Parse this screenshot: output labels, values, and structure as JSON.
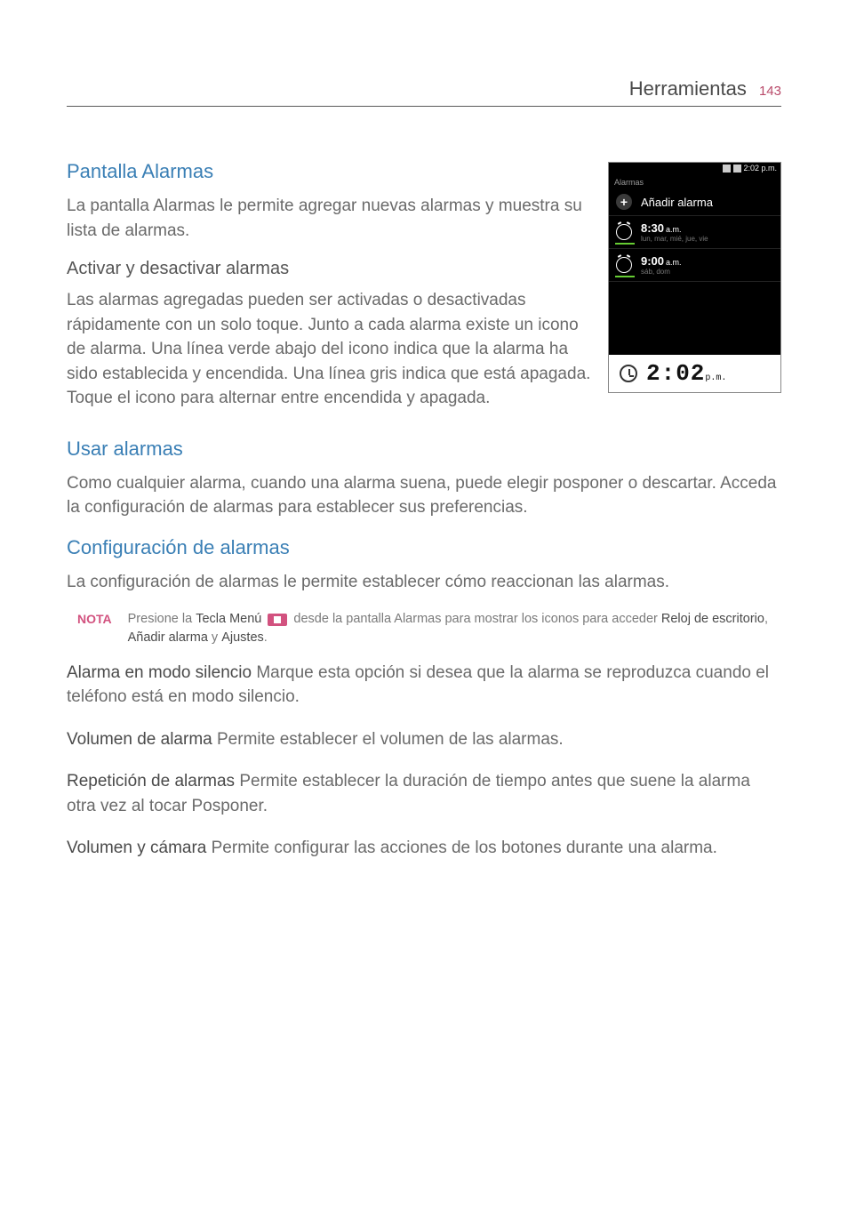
{
  "header": {
    "title": "Herramientas",
    "page_number": "143"
  },
  "sections": {
    "pantalla": {
      "title": "Pantalla Alarmas",
      "body": "La pantalla Alarmas le permite agregar nuevas alarmas y muestra su lista de alarmas."
    },
    "activar": {
      "title": "Activar y desactivar alarmas",
      "body": "Las alarmas agregadas pueden ser activadas o desactivadas rápidamente con un solo toque. Junto a cada alarma existe un icono de alarma. Una línea verde abajo del icono indica que la alarma ha sido establecida y encendida. Una línea gris indica que está apagada. Toque el icono para alternar entre encendida y apagada."
    },
    "usar": {
      "title": "Usar alarmas",
      "body": "Como cualquier alarma, cuando una alarma suena, puede elegir posponer o descartar. Acceda la configuración de alarmas para establecer sus preferencias."
    },
    "config": {
      "title": "Configuración de alarmas",
      "body": "La configuración de alarmas le permite establecer cómo reaccionan las alarmas."
    }
  },
  "note": {
    "label": "NOTA",
    "pre": "Presione la ",
    "tecla": "Tecla Menú",
    "post1": " desde la pantalla Alarmas para mostrar los iconos para acceder ",
    "b1": "Reloj de escritorio",
    "sep1": ", ",
    "b2": "Añadir alarma",
    "sep2": " y ",
    "b3": "Ajustes",
    "dot": "."
  },
  "options": {
    "silencio": {
      "lead": "Alarma en modo silencio",
      "rest": " Marque esta opción si desea que la alarma se reproduzca cuando el teléfono está en modo silencio."
    },
    "volumen": {
      "lead": "Volumen de alarma",
      "rest": " Permite establecer el volumen de las alarmas."
    },
    "rep": {
      "lead": "Repetición de alarmas",
      "rest": " Permite establecer la duración de tiempo antes que suene la alarma otra vez al tocar Posponer."
    },
    "volcam": {
      "lead": "Volumen y cámara",
      "rest": " Permite configurar las acciones de los botones durante una alarma."
    }
  },
  "screenshot": {
    "status_time": "2:02 p.m.",
    "tab": "Alarmas",
    "add": "Añadir alarma",
    "a1_time": "8:30",
    "a1_ampm": "a.m.",
    "a1_days": "lun, mar, mié, jue, vie",
    "a2_time": "9:00",
    "a2_ampm": "a.m.",
    "a2_days": "sáb, dom",
    "clock": "2:02",
    "clock_pm": "p.m."
  }
}
